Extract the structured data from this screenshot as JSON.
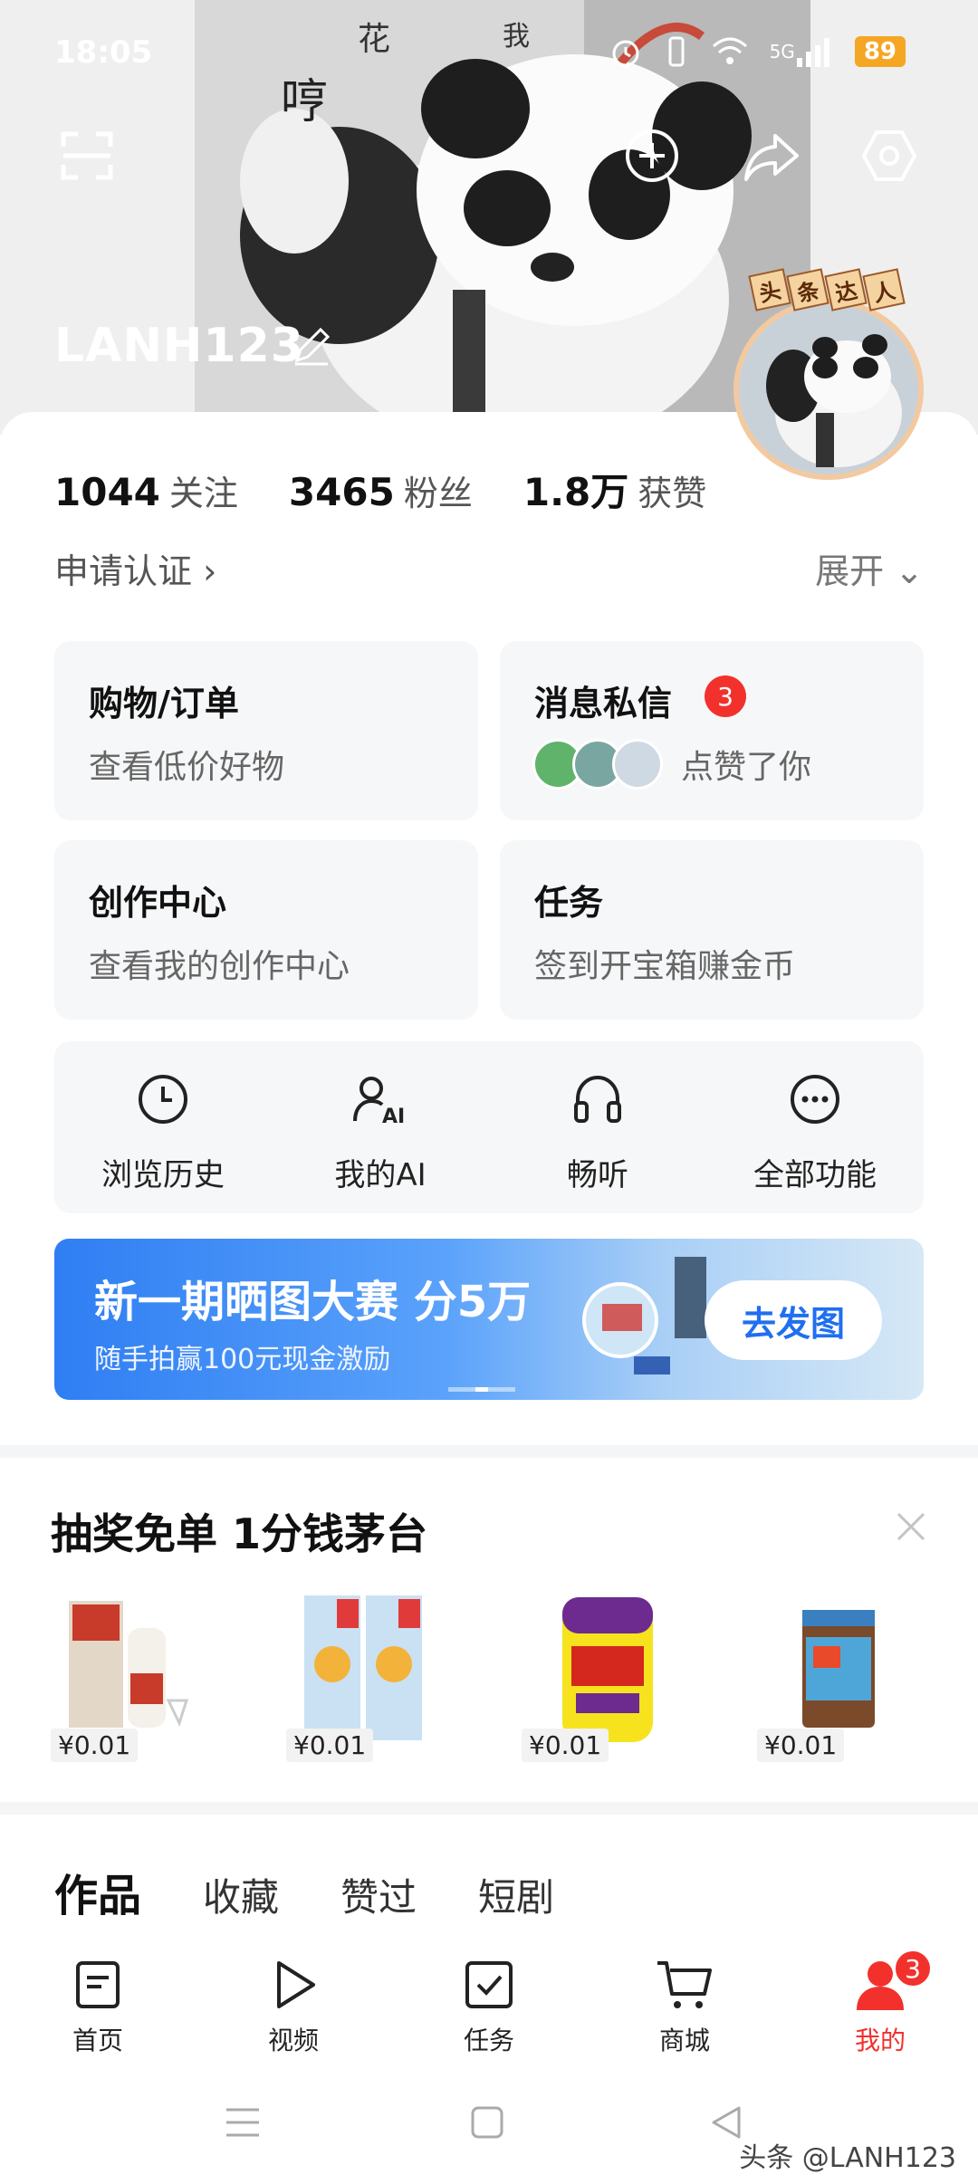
{
  "status_bar": {
    "time": "18:05",
    "signal": "5G",
    "battery": "89"
  },
  "profile": {
    "username": "LANH123"
  },
  "avatar": {
    "badge_chars": [
      "头",
      "条",
      "达",
      "人"
    ]
  },
  "stats": [
    {
      "value": "1044",
      "label": "关注"
    },
    {
      "value": "3465",
      "label": "粉丝"
    },
    {
      "value": "1.8万",
      "label": "获赞"
    }
  ],
  "links": {
    "verify": "申请认证 ›",
    "expand": "展开 ⌄"
  },
  "tiles": {
    "shop": {
      "title": "购物/订单",
      "subtitle": "查看低价好物"
    },
    "messages": {
      "title": "消息私信",
      "badge": "3",
      "subtitle": "点赞了你"
    },
    "create": {
      "title": "创作中心",
      "subtitle": "查看我的创作中心"
    },
    "task": {
      "title": "任务",
      "subtitle": "签到开宝箱赚金币"
    }
  },
  "tools": [
    {
      "label": "浏览历史",
      "icon": "clock-icon"
    },
    {
      "label": "我的AI",
      "icon": "ai-person-icon"
    },
    {
      "label": "畅听",
      "icon": "headphones-icon"
    },
    {
      "label": "全部功能",
      "icon": "more-icon"
    }
  ],
  "promo": {
    "title": "新一期晒图大赛 分5万",
    "subtitle": "随手拍赢100元现金激励",
    "button": "去发图"
  },
  "lottery": {
    "title": "抽奖免单 1分钱茅台",
    "products": [
      {
        "price": "¥0.01"
      },
      {
        "price": "¥0.01"
      },
      {
        "price": "¥0.01"
      },
      {
        "price": "¥0.01"
      }
    ]
  },
  "content_tabs": [
    "作品",
    "收藏",
    "赞过",
    "短剧"
  ],
  "bottom_nav": [
    {
      "label": "首页",
      "icon": "home-doc-icon"
    },
    {
      "label": "视频",
      "icon": "play-icon"
    },
    {
      "label": "任务",
      "icon": "task-check-icon"
    },
    {
      "label": "商城",
      "icon": "cart-icon"
    },
    {
      "label": "我的",
      "icon": "profile-icon",
      "badge": "3"
    }
  ],
  "watermark": "头条 @LANH123",
  "colors": {
    "accent_red": "#f2312d",
    "promo_blue": "#2f7ef3",
    "battery": "#f5a623"
  }
}
